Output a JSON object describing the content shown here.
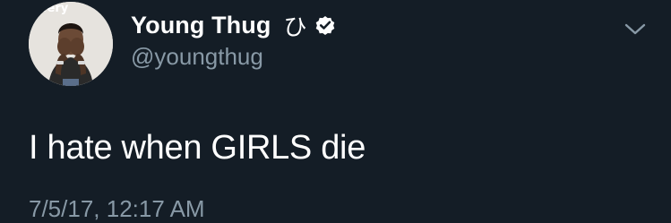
{
  "tweet": {
    "author": {
      "display_name": "Young Thug",
      "name_emoji": "ひ",
      "handle": "@youngthug",
      "verified": true,
      "avatar_text": "ffery"
    },
    "text": "I hate when GIRLS die",
    "timestamp": "7/5/17, 12:17 AM",
    "icons": {
      "verified": "verified-badge-icon",
      "menu": "chevron-down-icon"
    }
  },
  "colors": {
    "background": "#141d26",
    "primary_text": "#ffffff",
    "secondary_text": "#8899a6"
  }
}
